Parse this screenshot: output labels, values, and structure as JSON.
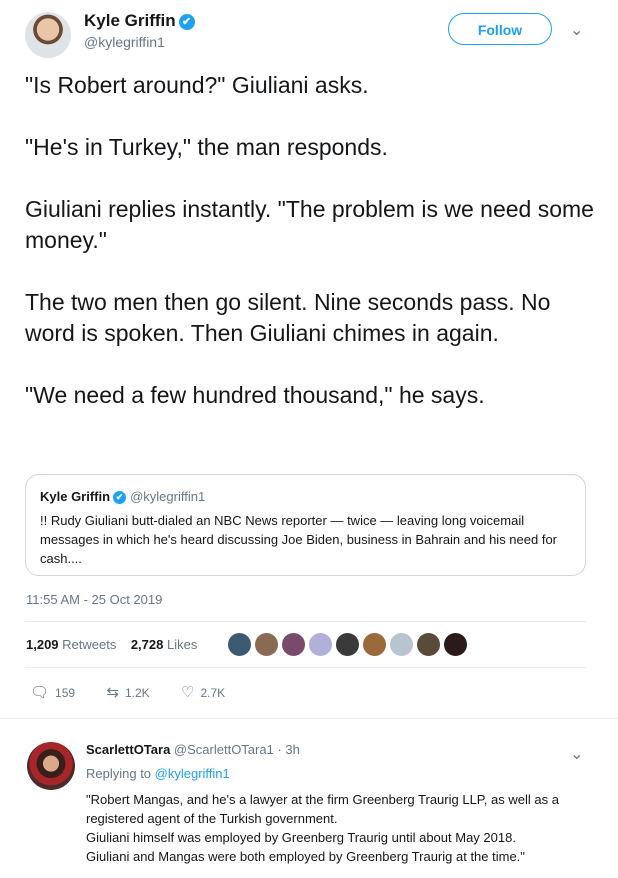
{
  "author": {
    "name": "Kyle Griffin",
    "handle": "@kylegriffin1",
    "follow_label": "Follow",
    "verified_mark": "✔"
  },
  "tweet": {
    "paragraphs": [
      "\"Is Robert around?\" Giuliani asks.",
      "\"He's in Turkey,\" the man responds.",
      "Giuliani replies instantly. \"The problem is we need some money.\"",
      "The two men then go silent. Nine seconds pass. No word is spoken. Then Giuliani chimes in again.",
      "\"We need a few hundred thousand,\" he says."
    ],
    "timestamp": "11:55 AM - 25 Oct 2019"
  },
  "quoted_tweet": {
    "name": "Kyle Griffin",
    "handle": "@kylegriffin1",
    "text": "!! Rudy Giuliani butt-dialed an NBC News reporter — twice — leaving long voicemail messages in which he's heard discussing Joe Biden, business in Bahrain and his need for cash...."
  },
  "stats": {
    "retweets_count": "1,209",
    "retweets_label": "Retweets",
    "likes_count": "2,728",
    "likes_label": "Likes",
    "liker_colors": [
      "#3d5a73",
      "#8a6a55",
      "#7a4a6a",
      "#b0b0d8",
      "#3a3a3a",
      "#9a6a3a",
      "#b8c4cf",
      "#5a4a3a",
      "#2a1a1a"
    ]
  },
  "actions": {
    "reply_count": "159",
    "retweet_count": "1.2K",
    "like_count": "2.7K"
  },
  "reply": {
    "name": "ScarlettOTara",
    "handle": "@ScarlettOTara1",
    "time": "· 3h",
    "replying_prefix": "Replying to ",
    "replying_to": "@kylegriffin1",
    "lines": [
      "\"Robert Mangas, and he's a lawyer at the firm Greenberg Traurig LLP, as well as a registered agent of the Turkish government.",
      "Giuliani himself was employed by Greenberg Traurig until about May 2018.",
      "Giuliani and Mangas were both employed by Greenberg Traurig at the time.\""
    ]
  },
  "colors": {
    "accent": "#1da1f2",
    "muted": "#657786",
    "border": "#e6ecf0"
  }
}
